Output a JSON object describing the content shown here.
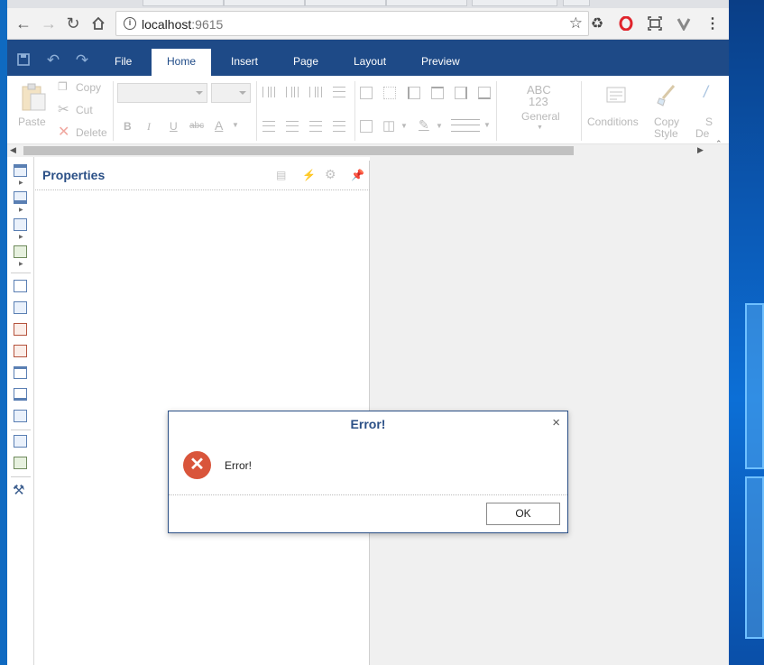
{
  "browser": {
    "url_host": "localhost",
    "url_port": ":9615",
    "info_icon": "i"
  },
  "ribbon": {
    "tabs": [
      {
        "label": "File"
      },
      {
        "label": "Home"
      },
      {
        "label": "Insert"
      },
      {
        "label": "Page"
      },
      {
        "label": "Layout"
      },
      {
        "label": "Preview"
      }
    ],
    "active_tab": "Home",
    "clipboard": {
      "paste": "Paste",
      "copy": "Copy",
      "cut": "Cut",
      "delete": "Delete"
    },
    "font_buttons": {
      "bold": "B",
      "italic": "I",
      "underline": "U",
      "strike": "abc",
      "color": "A"
    },
    "number_format": {
      "icon_line1": "ABC",
      "icon_line2": "123",
      "label": "General"
    },
    "conditions_label": "Conditions",
    "copy_style_label_1": "Copy",
    "copy_style_label_2": "Style",
    "style_partial_1": "S",
    "style_partial_2": "De"
  },
  "properties": {
    "title": "Properties"
  },
  "dialog": {
    "title": "Error!",
    "message": "Error!",
    "ok_label": "OK",
    "close_glyph": "×",
    "icon_glyph": "✕"
  },
  "colors": {
    "ribbon_bar": "#1e4a87",
    "dialog_title": "#2a4f86",
    "error_icon": "#d9553b"
  }
}
